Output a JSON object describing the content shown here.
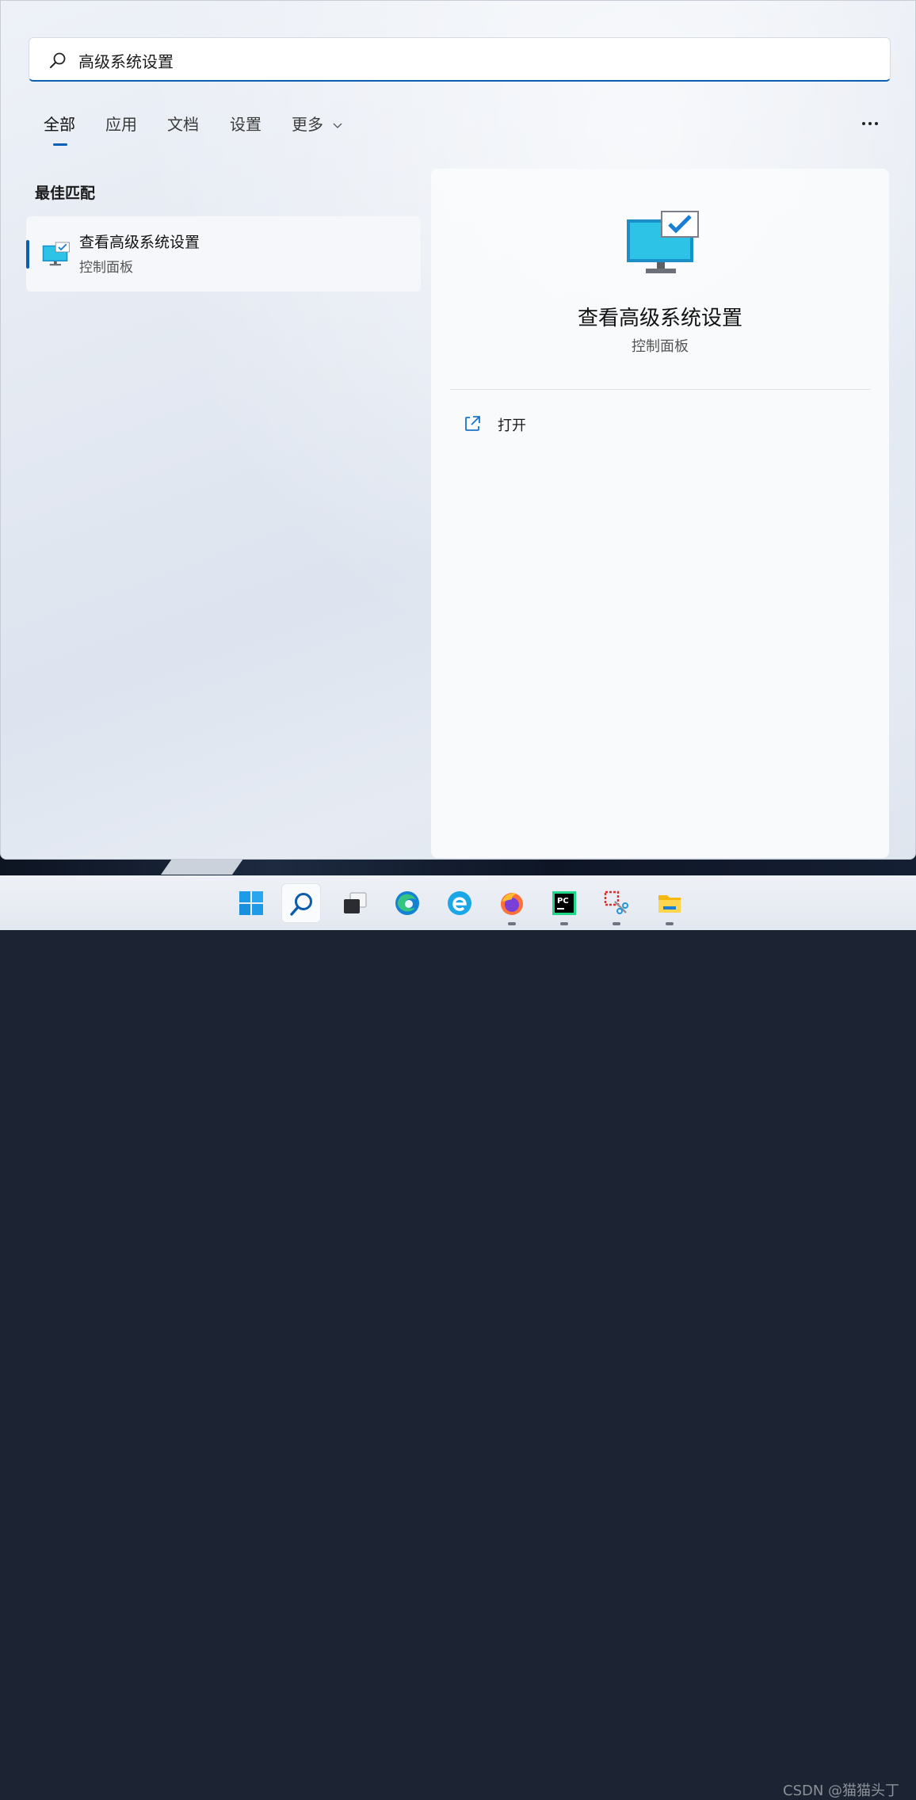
{
  "search": {
    "value": "高级系统设置"
  },
  "tabs": [
    {
      "label": "全部",
      "active": true
    },
    {
      "label": "应用"
    },
    {
      "label": "文档"
    },
    {
      "label": "设置"
    },
    {
      "label": "更多"
    }
  ],
  "more_options_label": "...",
  "best_match": {
    "section_title": "最佳匹配",
    "result": {
      "title": "查看高级系统设置",
      "subtitle": "控制面板",
      "icon": "computer-checkmark-icon"
    }
  },
  "detail": {
    "title": "查看高级系统设置",
    "subtitle": "控制面板",
    "icon": "computer-checkmark-icon",
    "actions": [
      {
        "label": "打开",
        "icon": "open-external-icon"
      }
    ]
  },
  "taskbar": {
    "items": [
      {
        "name": "start",
        "icon": "windows-logo-icon"
      },
      {
        "name": "search",
        "icon": "search-icon",
        "active": true
      },
      {
        "name": "task-view",
        "icon": "task-view-icon"
      },
      {
        "name": "edge",
        "icon": "edge-icon"
      },
      {
        "name": "ie",
        "icon": "ie-icon"
      },
      {
        "name": "firefox",
        "icon": "firefox-icon",
        "running": true
      },
      {
        "name": "pycharm",
        "icon": "pycharm-icon",
        "running": true
      },
      {
        "name": "snipping-tool",
        "icon": "snipping-tool-icon",
        "running": true
      },
      {
        "name": "file-explorer",
        "icon": "folder-icon",
        "running": true
      }
    ]
  },
  "watermark": "CSDN @猫猫头丁",
  "colors": {
    "accent": "#0a5fb4",
    "panel_bg": "#e4e9f2"
  }
}
